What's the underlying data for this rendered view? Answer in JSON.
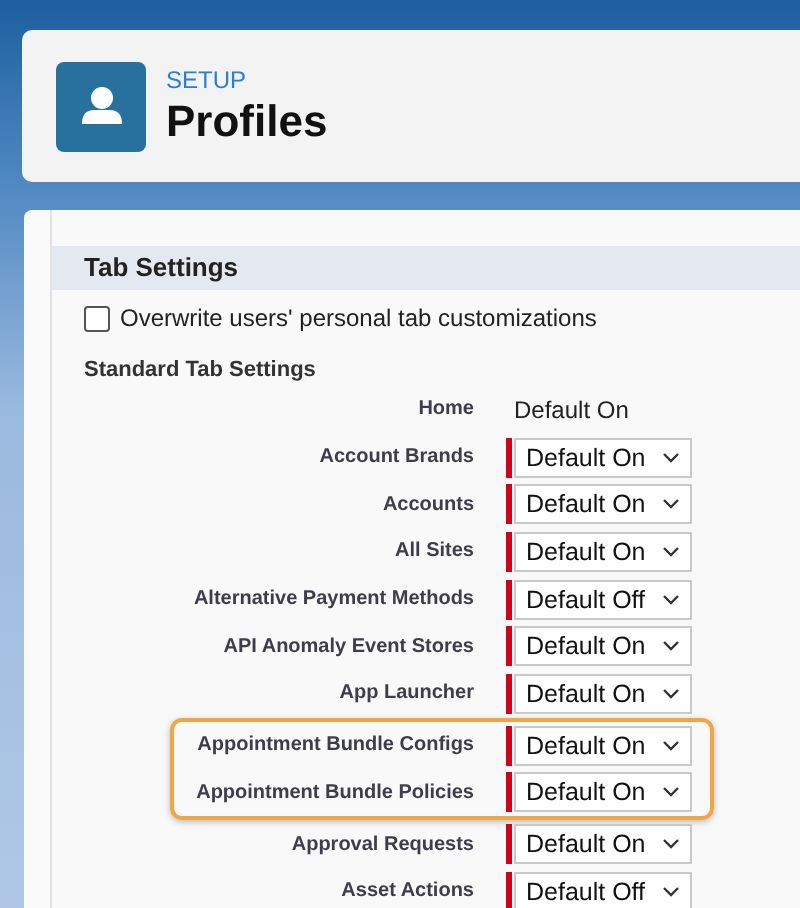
{
  "header": {
    "eyebrow": "SETUP",
    "title": "Profiles"
  },
  "section": {
    "title": "Tab Settings"
  },
  "overwrite": {
    "label": "Overwrite users' personal tab customizations",
    "checked": false
  },
  "subsection": "Standard Tab Settings",
  "rows": [
    {
      "label": "Home",
      "kind": "static",
      "value": "Default On",
      "highlighted": false
    },
    {
      "label": "Account Brands",
      "kind": "select",
      "value": "Default On",
      "highlighted": false
    },
    {
      "label": "Accounts",
      "kind": "select",
      "value": "Default On",
      "highlighted": false
    },
    {
      "label": "All Sites",
      "kind": "select",
      "value": "Default On",
      "highlighted": false
    },
    {
      "label": "Alternative Payment Methods",
      "kind": "select",
      "value": "Default Off",
      "highlighted": false
    },
    {
      "label": "API Anomaly Event Stores",
      "kind": "select",
      "value": "Default On",
      "highlighted": false
    },
    {
      "label": "App Launcher",
      "kind": "select",
      "value": "Default On",
      "highlighted": false
    },
    {
      "label": "Appointment Bundle Configs",
      "kind": "select",
      "value": "Default On",
      "highlighted": true
    },
    {
      "label": "Appointment Bundle Policies",
      "kind": "select",
      "value": "Default On",
      "highlighted": true
    },
    {
      "label": "Approval Requests",
      "kind": "select",
      "value": "Default On",
      "highlighted": false
    },
    {
      "label": "Asset Actions",
      "kind": "select",
      "value": "Default Off",
      "highlighted": false
    }
  ]
}
